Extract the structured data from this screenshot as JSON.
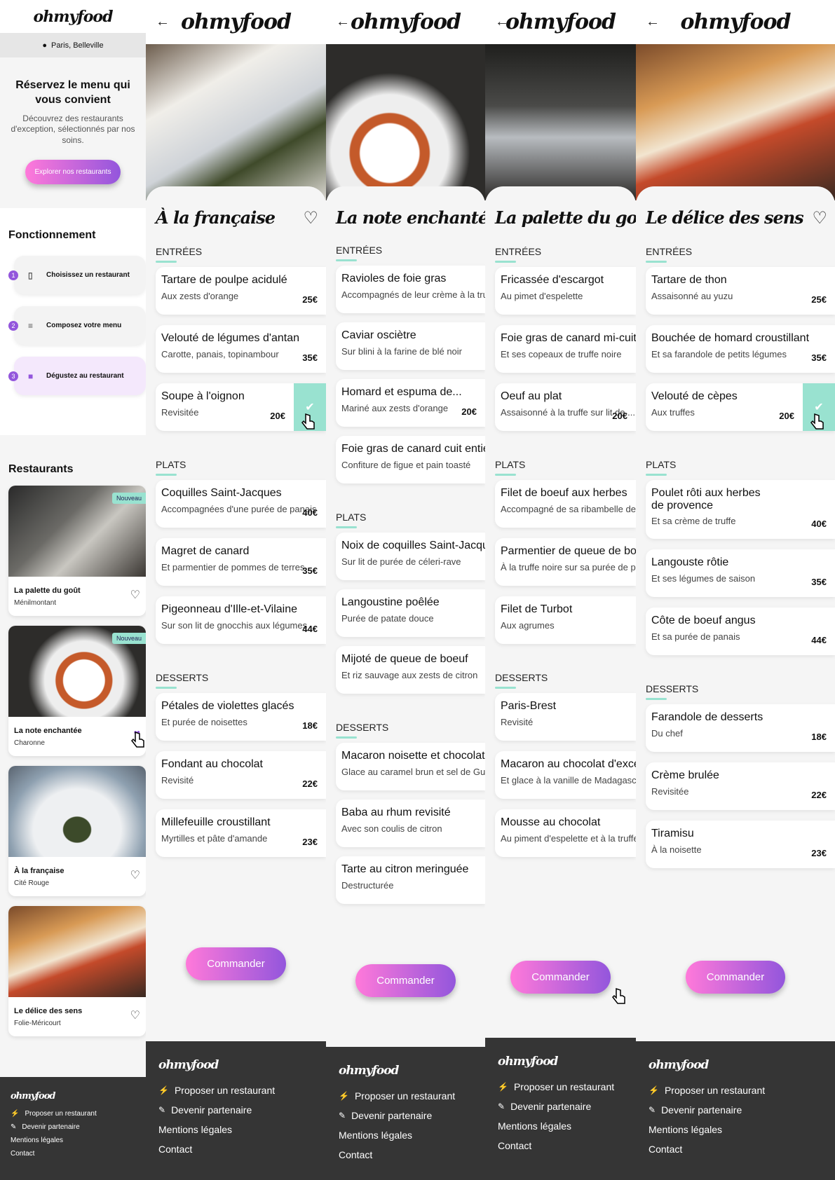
{
  "brand": "ohmyfood",
  "home": {
    "location": "Paris, Belleville",
    "hero_title": "Réservez le menu qui vous convient",
    "hero_subtitle": "Découvrez des restaurants d'exception, sélectionnés par nos soins.",
    "hero_button": "Explorer nos restaurants",
    "how_title": "Fonctionnement",
    "steps": [
      {
        "num": "1",
        "label": "Choisissez un restaurant",
        "icon": "phone-icon"
      },
      {
        "num": "2",
        "label": "Composez votre menu",
        "icon": "list-icon"
      },
      {
        "num": "3",
        "label": "Dégustez au restaurant",
        "icon": "store-icon"
      }
    ],
    "restaurants_title": "Restaurants",
    "restaurants": [
      {
        "name": "La palette du goût",
        "area": "Ménilmontant",
        "badge": "Nouveau",
        "liked": false
      },
      {
        "name": "La note enchantée",
        "area": "Charonne",
        "badge": "Nouveau",
        "liked": true
      },
      {
        "name": "À la française",
        "area": "Cité Rouge",
        "badge": "",
        "liked": false
      },
      {
        "name": "Le délice des sens",
        "area": "Folie-Méricourt",
        "badge": "",
        "liked": false
      }
    ]
  },
  "footer": {
    "links": [
      "Proposer un restaurant",
      "Devenir partenaire",
      "Mentions légales",
      "Contact"
    ]
  },
  "menus": [
    {
      "title": "À la française",
      "sections": [
        {
          "name": "ENTRÉES",
          "dishes": [
            {
              "name": "Tartare de poulpe acidulé",
              "desc": "Aux zests d'orange",
              "price": "25€"
            },
            {
              "name": "Velouté de légumes d'antan",
              "desc": "Carotte, panais, topinambour",
              "price": "35€"
            },
            {
              "name": "Soupe à l'oignon",
              "desc": "Revisitée",
              "price": "20€",
              "selected": true
            }
          ]
        },
        {
          "name": "PLATS",
          "dishes": [
            {
              "name": "Coquilles Saint-Jacques",
              "desc": "Accompagnées d'une purée de panais",
              "price": "40€"
            },
            {
              "name": "Magret de canard",
              "desc": "Et parmentier de pommes de terres",
              "price": "35€"
            },
            {
              "name": "Pigeonneau d'Ille-et-Vilaine",
              "desc": "Sur son lit de gnocchis aux légumes",
              "price": "44€"
            }
          ]
        },
        {
          "name": "DESSERTS",
          "dishes": [
            {
              "name": "Pétales de violettes glacés",
              "desc": "Et purée de noisettes",
              "price": "18€"
            },
            {
              "name": "Fondant au chocolat",
              "desc": "Revisité",
              "price": "22€"
            },
            {
              "name": "Millefeuille croustillant",
              "desc": "Myrtilles et pâte d'amande",
              "price": "23€"
            }
          ]
        }
      ]
    },
    {
      "title": "La note enchantée",
      "sections": [
        {
          "name": "ENTRÉES",
          "dishes": [
            {
              "name": "Ravioles de foie gras",
              "desc": "Accompagnés de leur crème à la truffe",
              "price": ""
            },
            {
              "name": "Caviar osciètre",
              "desc": "Sur blini à la farine de blé noir",
              "price": ""
            },
            {
              "name": "Homard et espuma de...",
              "desc": "Mariné aux zests d'orange",
              "price": "20€"
            },
            {
              "name": "Foie gras de canard cuit entier",
              "desc": "Confiture de figue et pain toasté",
              "price": ""
            }
          ]
        },
        {
          "name": "PLATS",
          "dishes": [
            {
              "name": "Noix de coquilles Saint-Jacques",
              "desc": "Sur lit de purée de céleri-rave",
              "price": ""
            },
            {
              "name": "Langoustine poêlée",
              "desc": "Purée de patate douce",
              "price": ""
            },
            {
              "name": "Mijoté de queue de boeuf",
              "desc": "Et riz sauvage aux zests de citron",
              "price": ""
            }
          ]
        },
        {
          "name": "DESSERTS",
          "dishes": [
            {
              "name": "Macaron noisette et chocolat",
              "desc": "Glace au caramel brun et sel de Guérande",
              "price": ""
            },
            {
              "name": "Baba au rhum revisité",
              "desc": "Avec son coulis de citron",
              "price": ""
            },
            {
              "name": "Tarte au citron meringuée",
              "desc": "Destructurée",
              "price": ""
            }
          ]
        }
      ]
    },
    {
      "title": "La palette du goût",
      "sections": [
        {
          "name": "ENTRÉES",
          "dishes": [
            {
              "name": "Fricassée d'escargot",
              "desc": "Au pimet d'espelette",
              "price": ""
            },
            {
              "name": "Foie gras de canard mi-cuit",
              "desc": "Et ses copeaux de truffe noire",
              "price": ""
            },
            {
              "name": "Oeuf au plat",
              "desc": "Assaisonné à la truffe sur lit de....",
              "price": "20€"
            }
          ]
        },
        {
          "name": "PLATS",
          "dishes": [
            {
              "name": "Filet de boeuf aux herbes",
              "desc": "Accompagné de sa ribambelle de légu...",
              "price": ""
            },
            {
              "name": "Parmentier de queue de boeuf",
              "desc": "À la truffe noire sur sa purée de panais",
              "price": ""
            },
            {
              "name": "Filet de Turbot",
              "desc": "Aux agrumes",
              "price": ""
            }
          ]
        },
        {
          "name": "DESSERTS",
          "dishes": [
            {
              "name": "Paris-Brest",
              "desc": "Revisité",
              "price": ""
            },
            {
              "name": "Macaron au chocolat d'exception",
              "desc": "Et glace à la vanille de Madagascar",
              "price": ""
            },
            {
              "name": "Mousse au chocolat",
              "desc": "Au piment d'espelette et à la truffe noire",
              "price": ""
            }
          ]
        }
      ]
    },
    {
      "title": "Le délice des sens",
      "sections": [
        {
          "name": "ENTRÉES",
          "dishes": [
            {
              "name": "Tartare de thon",
              "desc": "Assaisonné au yuzu",
              "price": "25€"
            },
            {
              "name": "Bouchée de homard croustillant",
              "desc": "Et sa farandole de petits légumes",
              "price": "35€"
            },
            {
              "name": "Velouté de cèpes",
              "desc": "Aux truffes",
              "price": "20€",
              "selected": true
            }
          ]
        },
        {
          "name": "PLATS",
          "dishes": [
            {
              "name": "Poulet rôti aux herbes de provence",
              "desc": "Et sa crème de truffe",
              "price": "40€",
              "tall": true
            },
            {
              "name": "Langouste rôtie",
              "desc": "Et ses légumes de saison",
              "price": "35€"
            },
            {
              "name": "Côte de boeuf angus",
              "desc": "Et sa purée de panais",
              "price": "44€"
            }
          ]
        },
        {
          "name": "DESSERTS",
          "dishes": [
            {
              "name": "Farandole de desserts",
              "desc": "Du chef",
              "price": "18€"
            },
            {
              "name": "Crème brulée",
              "desc": "Revisitée",
              "price": "22€"
            },
            {
              "name": "Tiramisu",
              "desc": "À la noisette",
              "price": "23€"
            }
          ]
        }
      ]
    }
  ],
  "order_button": "Commander",
  "colors": {
    "accent": "#9356dc",
    "accent_light": "#ff79da",
    "mint": "#99e2d0",
    "footer": "#353535"
  }
}
